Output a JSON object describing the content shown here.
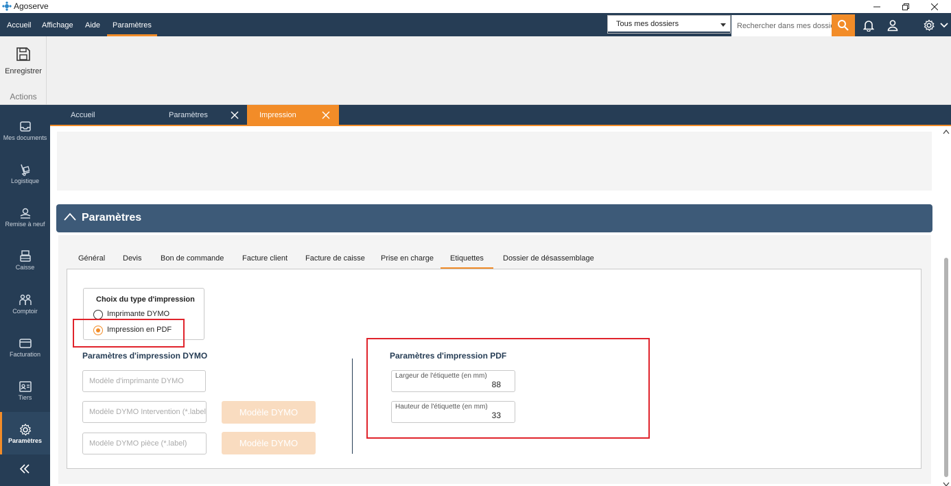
{
  "window": {
    "title": "Agoserve"
  },
  "menu": {
    "items": [
      "Accueil",
      "Affichage",
      "Aide",
      "Paramètres"
    ],
    "active": "Paramètres"
  },
  "header": {
    "scope_select": "Tous mes dossiers",
    "search_placeholder": "Rechercher dans mes dossiers"
  },
  "ribbon": {
    "save_label": "Enregistrer",
    "group_label": "Actions"
  },
  "sidebar": {
    "items": [
      "Mes documents",
      "Logistique",
      "Remise à neuf",
      "Caisse",
      "Comptoir",
      "Facturation",
      "Tiers",
      "Paramètres"
    ],
    "active": "Paramètres"
  },
  "doc_tabs": [
    "Accueil",
    "Paramètres",
    "Impression"
  ],
  "section": {
    "title": "Paramètres"
  },
  "sub_tabs": {
    "items": [
      "Général",
      "Devis",
      "Bon de commande",
      "Facture client",
      "Facture de caisse",
      "Prise en charge",
      "Etiquettes",
      "Dossier de désassemblage"
    ],
    "active": "Etiquettes"
  },
  "print_type": {
    "title": "Choix du type d'impression",
    "options": [
      "Imprimante DYMO",
      "Impression en PDF"
    ],
    "selected": "Impression en PDF"
  },
  "dymo": {
    "heading": "Paramètres d'impression DYMO",
    "printer_placeholder": "Modèle d'imprimante DYMO",
    "intervention_placeholder": "Modèle DYMO Intervention (*.label)",
    "part_placeholder": "Modèle DYMO pièce (*.label)",
    "button_label": "Modèle DYMO"
  },
  "pdf": {
    "heading": "Paramètres d'impression PDF",
    "width_label": "Largeur de l'étiquette (en mm)",
    "width_value": "88",
    "height_label": "Hauteur de l'étiquette (en mm)",
    "height_value": "33"
  },
  "colors": {
    "primary": "#263d55",
    "accent": "#f28c28",
    "highlight": "#e0232b"
  }
}
